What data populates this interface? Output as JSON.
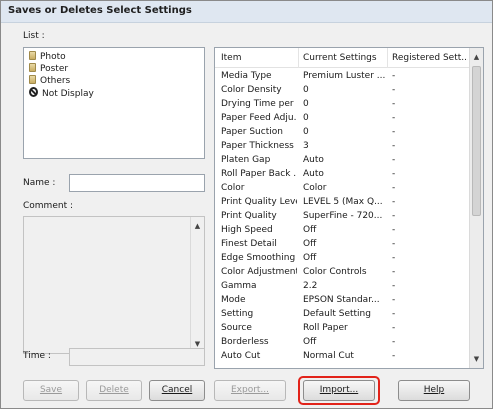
{
  "window": {
    "title": "Saves or Deletes Select Settings"
  },
  "list": {
    "label": "List :",
    "items": [
      {
        "label": "Photo",
        "icon": "folder-icon"
      },
      {
        "label": "Poster",
        "icon": "folder-icon"
      },
      {
        "label": "Others",
        "icon": "folder-icon"
      },
      {
        "label": "Not Display",
        "icon": "no-entry-icon"
      }
    ]
  },
  "name": {
    "label": "Name :",
    "value": ""
  },
  "comment": {
    "label": "Comment :",
    "value": ""
  },
  "time": {
    "label": "Time :",
    "value": ""
  },
  "buttons": {
    "save": "Save",
    "delete": "Delete",
    "cancel": "Cancel",
    "export": "Export...",
    "import": "Import...",
    "help": "Help"
  },
  "settings_table": {
    "headers": [
      "Item",
      "Current Settings",
      "Registered Sett..."
    ],
    "rows": [
      [
        "Media Type",
        "Premium Luster ...",
        "-"
      ],
      [
        "Color Density",
        "0",
        "-"
      ],
      [
        "Drying Time per ...",
        "0",
        "-"
      ],
      [
        "Paper Feed Adju...",
        "0",
        "-"
      ],
      [
        "Paper Suction",
        "0",
        "-"
      ],
      [
        "Paper Thickness",
        "3",
        "-"
      ],
      [
        "Platen Gap",
        "Auto",
        "-"
      ],
      [
        "Roll Paper Back ...",
        "Auto",
        "-"
      ],
      [
        "Color",
        "Color",
        "-"
      ],
      [
        "Print Quality Level",
        "LEVEL 5 (Max Q...",
        "-"
      ],
      [
        "Print Quality",
        "SuperFine - 720...",
        "-"
      ],
      [
        "High Speed",
        "Off",
        "-"
      ],
      [
        "Finest Detail",
        "Off",
        "-"
      ],
      [
        "Edge Smoothing",
        "Off",
        "-"
      ],
      [
        "Color Adjustment",
        "Color Controls",
        "-"
      ],
      [
        "Gamma",
        "2.2",
        "-"
      ],
      [
        "Mode",
        "EPSON Standar...",
        "-"
      ],
      [
        "Setting",
        "Default Setting",
        "-"
      ],
      [
        "Source",
        "Roll Paper",
        "-"
      ],
      [
        "Borderless",
        "Off",
        "-"
      ],
      [
        "Auto Cut",
        "Normal Cut",
        "-"
      ]
    ]
  },
  "scroll": {
    "up_arrow": "▲",
    "down_arrow": "▼"
  },
  "colors": {
    "highlight": "#e2231a",
    "titlebar": "#dfe7f1"
  }
}
